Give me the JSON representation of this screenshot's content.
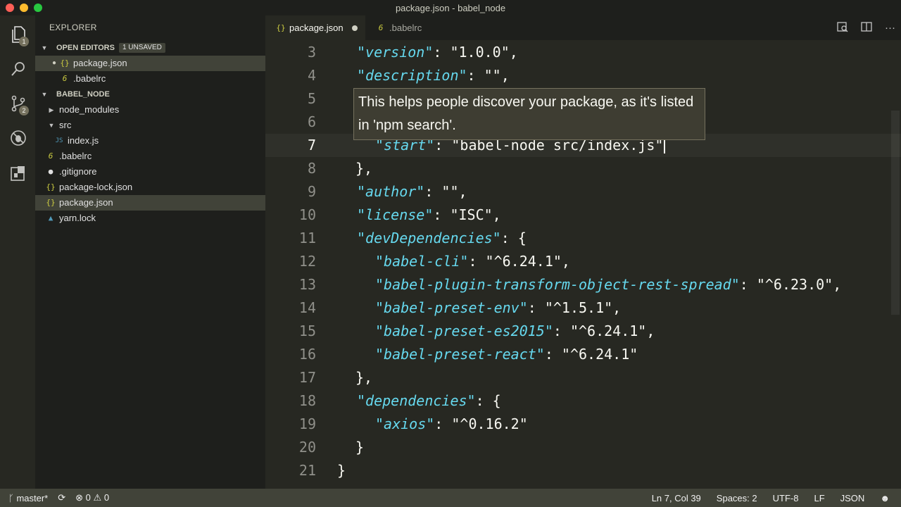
{
  "window": {
    "title": "package.json - babel_node"
  },
  "activity": {
    "explorer_badge": "1",
    "scm_badge": "2"
  },
  "sidebar": {
    "title": "EXPLORER",
    "open_editors": {
      "label": "OPEN EDITORS",
      "badge": "1 UNSAVED",
      "items": [
        {
          "name": "package.json",
          "icon": "json-icon"
        },
        {
          "name": ".babelrc",
          "icon": "babel-icon"
        }
      ]
    },
    "project": {
      "label": "BABEL_NODE",
      "items": [
        {
          "name": "node_modules"
        },
        {
          "name": "src"
        },
        {
          "name": "index.js"
        },
        {
          "name": ".babelrc"
        },
        {
          "name": ".gitignore"
        },
        {
          "name": "package-lock.json"
        },
        {
          "name": "package.json"
        },
        {
          "name": "yarn.lock"
        }
      ]
    }
  },
  "tabs": [
    {
      "label": "package.json",
      "state": "active, unsaved"
    },
    {
      "label": ".babelrc",
      "state": "inactive"
    }
  ],
  "editor": {
    "lines": [
      {
        "n": "3",
        "key": "\"version\"",
        "rest": ": \"1.0.0\","
      },
      {
        "n": "4",
        "key": "\"description\"",
        "rest": ": \"\","
      },
      {
        "n": "5",
        "key": "",
        "rest": ""
      },
      {
        "n": "6",
        "key": "",
        "rest": ""
      },
      {
        "n": "7",
        "key": "\"start\"",
        "rest": ": \"babel-node src/index.js\""
      },
      {
        "n": "8",
        "key": "",
        "rest": "},"
      },
      {
        "n": "9",
        "key": "\"author\"",
        "rest": ": \"\","
      },
      {
        "n": "10",
        "key": "\"license\"",
        "rest": ": \"ISC\","
      },
      {
        "n": "11",
        "key": "\"devDependencies\"",
        "rest": ": {"
      },
      {
        "n": "12",
        "key": "\"babel-cli\"",
        "rest": ": \"^6.24.1\","
      },
      {
        "n": "13",
        "key": "\"babel-plugin-transform-object-rest-spread\"",
        "rest": ": \"^6.23.0\","
      },
      {
        "n": "14",
        "key": "\"babel-preset-env\"",
        "rest": ": \"^1.5.1\","
      },
      {
        "n": "15",
        "key": "\"babel-preset-es2015\"",
        "rest": ": \"^6.24.1\","
      },
      {
        "n": "16",
        "key": "\"babel-preset-react\"",
        "rest": ": \"^6.24.1\""
      },
      {
        "n": "17",
        "key": "",
        "rest": "},"
      },
      {
        "n": "18",
        "key": "\"dependencies\"",
        "rest": ": {"
      },
      {
        "n": "19",
        "key": "\"axios\"",
        "rest": ": \"^0.16.2\""
      },
      {
        "n": "20",
        "key": "",
        "rest": "}"
      },
      {
        "n": "21",
        "key": "",
        "rest": "}"
      }
    ],
    "hover_text": "This helps people discover your package, as it's listed in 'npm search'."
  },
  "status": {
    "branch": "master*",
    "errors": "0",
    "warnings": "0",
    "position": "Ln 7, Col 39",
    "spaces": "Spaces: 2",
    "encoding": "UTF-8",
    "eol": "LF",
    "language": "JSON"
  }
}
